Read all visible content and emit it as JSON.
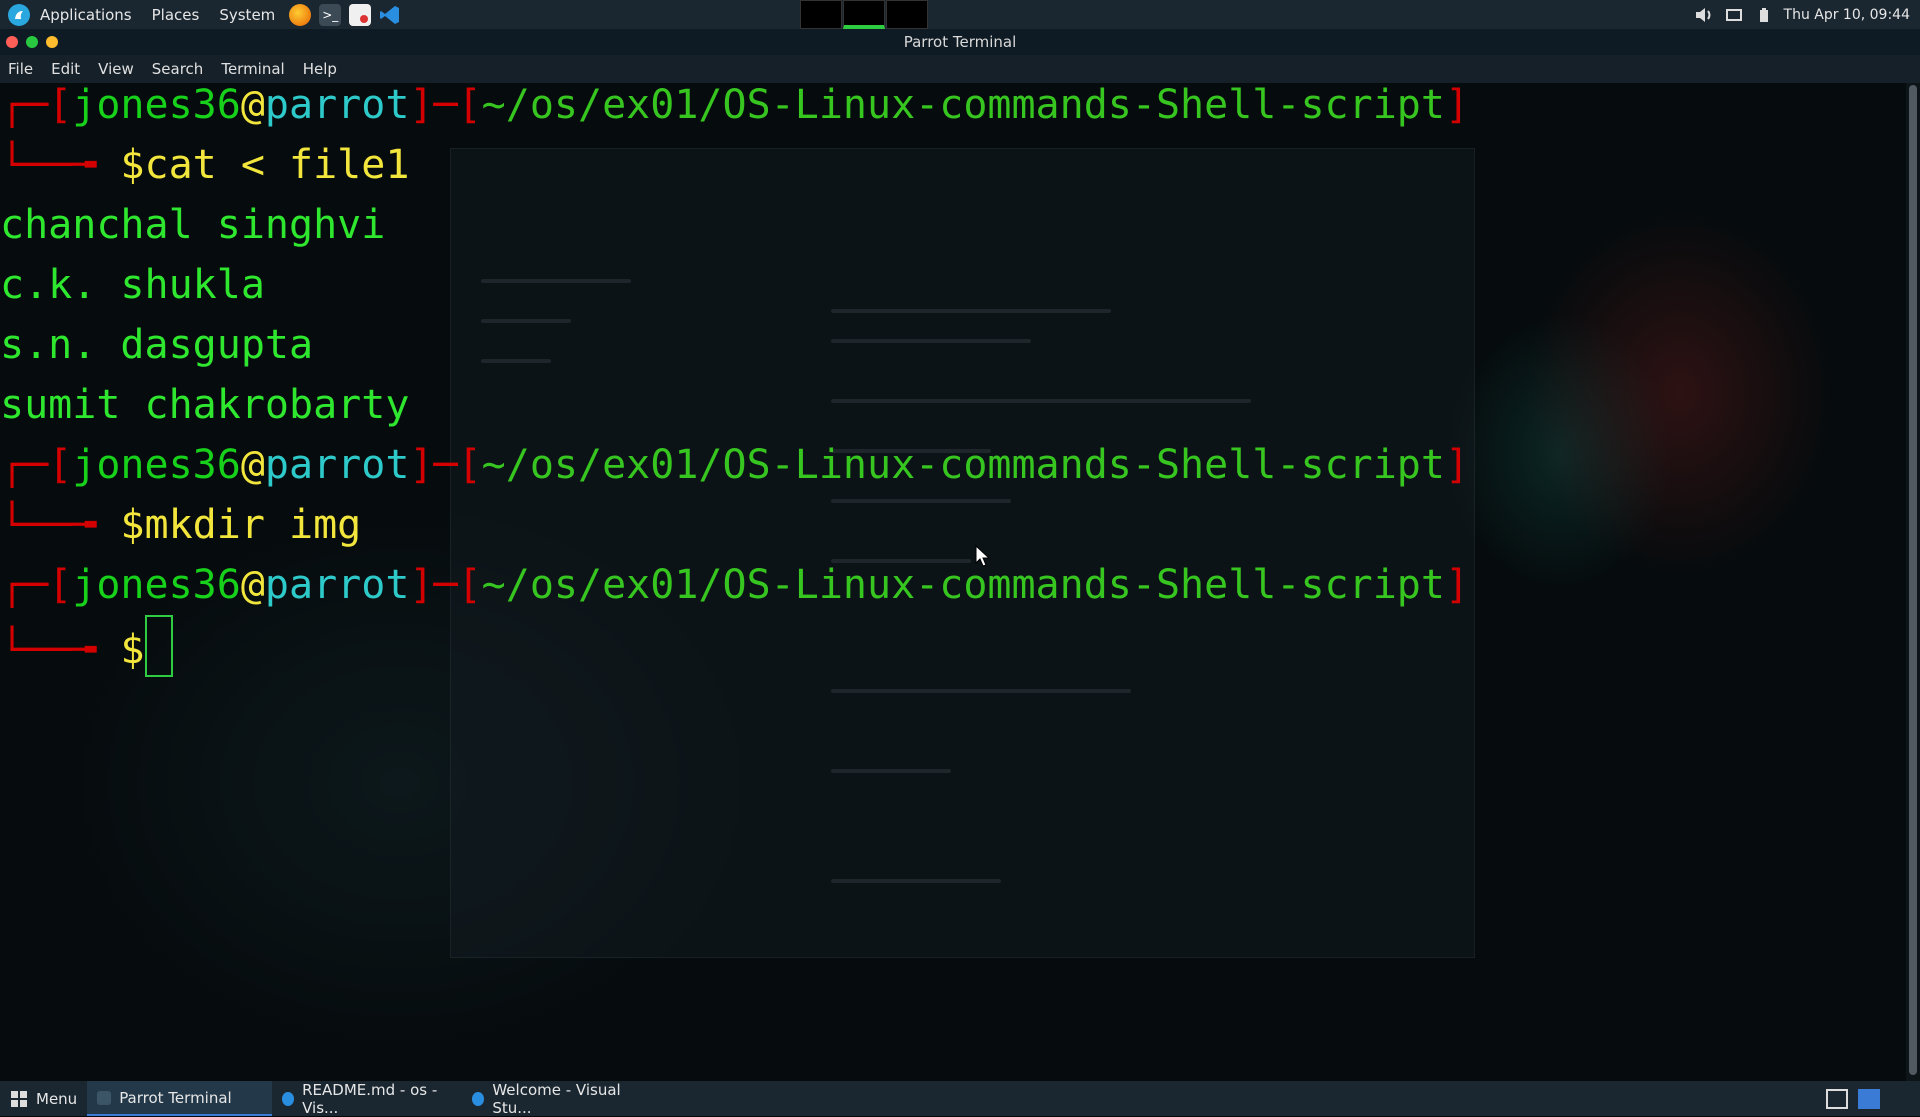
{
  "top_panel": {
    "menus": [
      "Applications",
      "Places",
      "System"
    ],
    "launchers": [
      "firefox-icon",
      "terminal-icon",
      "text-editor-icon",
      "vscode-icon"
    ],
    "clock": "Thu Apr 10, 09:44"
  },
  "window": {
    "title": "Parrot Terminal"
  },
  "menubar": [
    "File",
    "Edit",
    "View",
    "Search",
    "Terminal",
    "Help"
  ],
  "terminal": {
    "user": "jones36",
    "host": "parrot",
    "path": "~/os/ex01/OS-Linux-commands-Shell-script",
    "commands": [
      "cat < file1",
      "mkdir img",
      ""
    ],
    "output": [
      "chanchal singhvi",
      "c.k. shukla",
      "s.n. dasgupta",
      "sumit chakrobarty"
    ]
  },
  "taskbar": {
    "menu_label": "Menu",
    "tasks": [
      {
        "label": "Parrot Terminal",
        "active": true
      },
      {
        "label": "README.md - os - Vis...",
        "active": false
      },
      {
        "label": "Welcome - Visual Stu...",
        "active": false
      }
    ]
  },
  "colors": {
    "accent": "#2aa7de",
    "prompt_red": "#d40000",
    "user_green": "#17d11b",
    "host_cyan": "#2ec9c9",
    "path_green": "#37c520",
    "dollar_yellow": "#f2e63d"
  }
}
